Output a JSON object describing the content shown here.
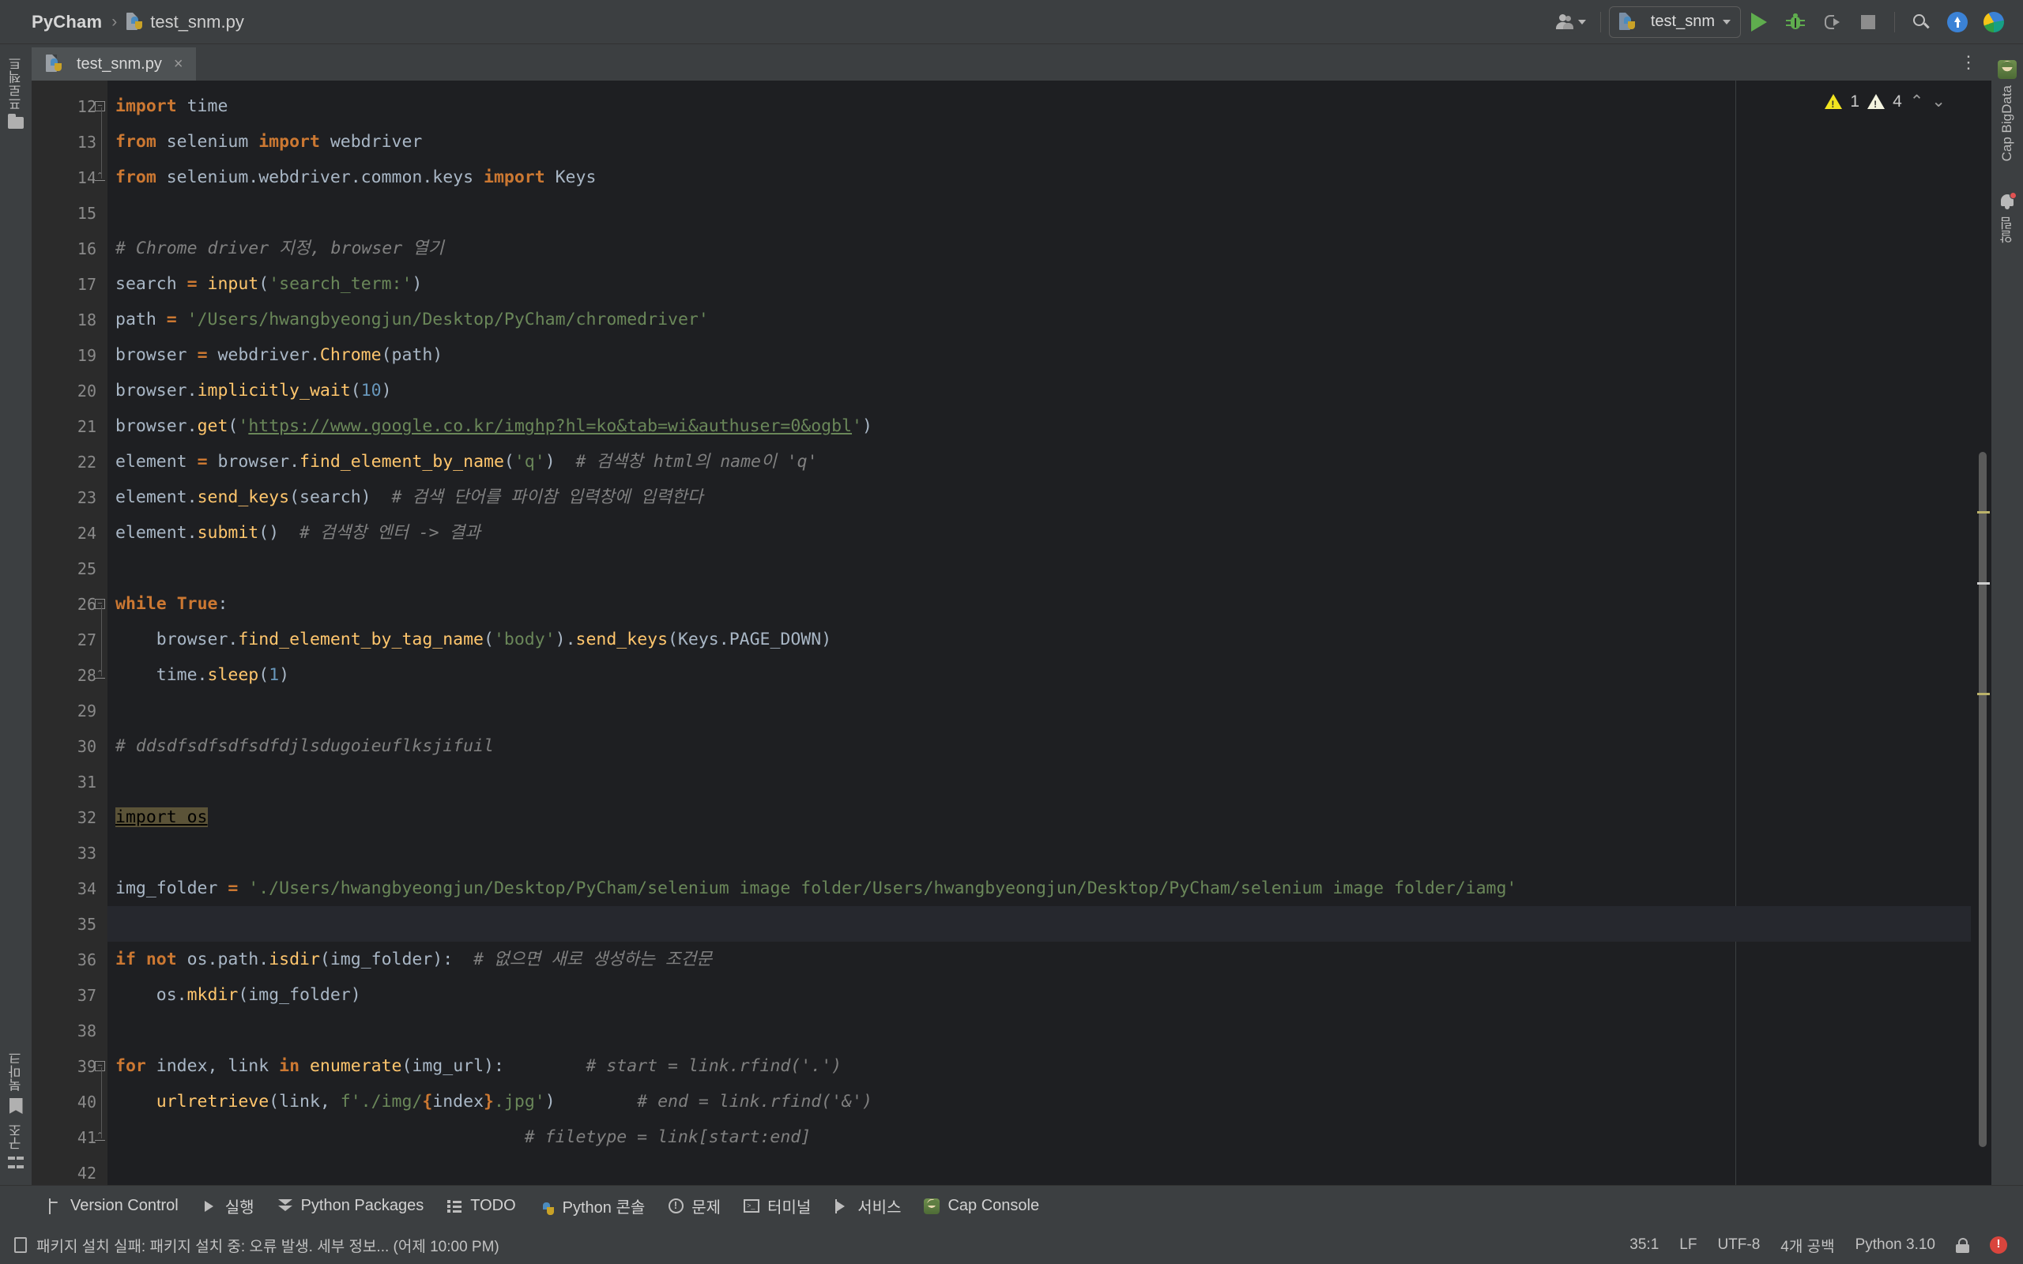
{
  "titlebar": {
    "project": "PyCham",
    "separator": "›",
    "file": "test_snm.py",
    "run_config": "test_snm",
    "icons": {
      "user": "user-accounts-icon",
      "run": "run-icon",
      "debug": "debug-icon",
      "coverage": "run-with-coverage-icon",
      "stop": "stop-icon",
      "search": "search-everywhere-icon",
      "update": "update-project-icon",
      "plugin": "code-with-me-icon"
    }
  },
  "left_rail": {
    "project": "프로젝트",
    "bookmarks": "북마크",
    "structure": "구조"
  },
  "right_rail": {
    "cap_bigdata": "Cap BigData",
    "notifications": "알림"
  },
  "tabs": [
    {
      "label": "test_snm.py",
      "close": "×",
      "active": true
    }
  ],
  "tab_overflow": "⋮",
  "inspections": {
    "warning_count": "1",
    "weak_warning_count": "4",
    "prev": "⌃",
    "next": "⌄"
  },
  "editor": {
    "first_line": 12,
    "current_line_index": 23,
    "lines": [
      {
        "n": 12,
        "fold": "minus",
        "tokens": [
          {
            "t": "import",
            "c": "k"
          },
          {
            "t": " time",
            "c": "id"
          }
        ]
      },
      {
        "n": 13,
        "tokens": [
          {
            "t": "from",
            "c": "k"
          },
          {
            "t": " selenium ",
            "c": "id"
          },
          {
            "t": "import",
            "c": "k"
          },
          {
            "t": " webdriver",
            "c": "id"
          }
        ]
      },
      {
        "n": 14,
        "fold": "end",
        "tokens": [
          {
            "t": "from",
            "c": "k"
          },
          {
            "t": " selenium.webdriver.common.keys ",
            "c": "id"
          },
          {
            "t": "import",
            "c": "k"
          },
          {
            "t": " Keys",
            "c": "id"
          }
        ]
      },
      {
        "n": 15,
        "tokens": []
      },
      {
        "n": 16,
        "tokens": [
          {
            "t": "# Chrome driver 지정, browser 열기",
            "c": "cm"
          }
        ]
      },
      {
        "n": 17,
        "tokens": [
          {
            "t": "search ",
            "c": "id"
          },
          {
            "t": "=",
            "c": "k"
          },
          {
            "t": " ",
            "c": "id"
          },
          {
            "t": "input",
            "c": "fn"
          },
          {
            "t": "(",
            "c": "pn"
          },
          {
            "t": "'search_term:'",
            "c": "s"
          },
          {
            "t": ")",
            "c": "pn"
          }
        ]
      },
      {
        "n": 18,
        "tokens": [
          {
            "t": "path ",
            "c": "id"
          },
          {
            "t": "=",
            "c": "k"
          },
          {
            "t": " ",
            "c": "id"
          },
          {
            "t": "'/Users/hwangbyeongjun/Desktop/PyCham/chromedriver'",
            "c": "s"
          }
        ]
      },
      {
        "n": 19,
        "tokens": [
          {
            "t": "browser ",
            "c": "id"
          },
          {
            "t": "=",
            "c": "k"
          },
          {
            "t": " webdriver.",
            "c": "id"
          },
          {
            "t": "Chrome",
            "c": "fn"
          },
          {
            "t": "(path)",
            "c": "pn"
          }
        ]
      },
      {
        "n": 20,
        "tokens": [
          {
            "t": "browser.",
            "c": "id"
          },
          {
            "t": "implicitly_wait",
            "c": "fn"
          },
          {
            "t": "(",
            "c": "pn"
          },
          {
            "t": "10",
            "c": "n"
          },
          {
            "t": ")",
            "c": "pn"
          }
        ]
      },
      {
        "n": 21,
        "tokens": [
          {
            "t": "browser.",
            "c": "id"
          },
          {
            "t": "get",
            "c": "fn"
          },
          {
            "t": "(",
            "c": "pn"
          },
          {
            "t": "'",
            "c": "s"
          },
          {
            "t": "https://www.google.co.kr/imghp?hl=ko&tab=wi&authuser=0&ogbl",
            "c": "url"
          },
          {
            "t": "'",
            "c": "s"
          },
          {
            "t": ")",
            "c": "pn"
          }
        ]
      },
      {
        "n": 22,
        "tokens": [
          {
            "t": "element ",
            "c": "id"
          },
          {
            "t": "=",
            "c": "k"
          },
          {
            "t": " browser.",
            "c": "id"
          },
          {
            "t": "find_element_by_name",
            "c": "fn"
          },
          {
            "t": "(",
            "c": "pn"
          },
          {
            "t": "'q'",
            "c": "s"
          },
          {
            "t": ")",
            "c": "pn"
          },
          {
            "t": "  # 검색창 html의 name이 'q'",
            "c": "cm"
          }
        ]
      },
      {
        "n": 23,
        "tokens": [
          {
            "t": "element.",
            "c": "id"
          },
          {
            "t": "send_keys",
            "c": "fn"
          },
          {
            "t": "(search)",
            "c": "pn"
          },
          {
            "t": "  # 검색 단어를 파이참 입력창에 입력한다",
            "c": "cm"
          }
        ]
      },
      {
        "n": 24,
        "tokens": [
          {
            "t": "element.",
            "c": "id"
          },
          {
            "t": "submit",
            "c": "fn"
          },
          {
            "t": "()",
            "c": "pn"
          },
          {
            "t": "  # 검색창 엔터 -> 결과",
            "c": "cm"
          }
        ]
      },
      {
        "n": 25,
        "tokens": []
      },
      {
        "n": 26,
        "fold": "minus",
        "tokens": [
          {
            "t": "while",
            "c": "k"
          },
          {
            "t": " ",
            "c": "id"
          },
          {
            "t": "True",
            "c": "k"
          },
          {
            "t": ":",
            "c": "pn"
          }
        ]
      },
      {
        "n": 27,
        "tokens": [
          {
            "t": "    browser.",
            "c": "id"
          },
          {
            "t": "find_element_by_tag_name",
            "c": "fn"
          },
          {
            "t": "(",
            "c": "pn"
          },
          {
            "t": "'body'",
            "c": "s"
          },
          {
            "t": ").",
            "c": "pn"
          },
          {
            "t": "send_keys",
            "c": "fn"
          },
          {
            "t": "(Keys.PAGE_DOWN)",
            "c": "pn"
          }
        ]
      },
      {
        "n": 28,
        "fold": "end",
        "tokens": [
          {
            "t": "    time.",
            "c": "id"
          },
          {
            "t": "sleep",
            "c": "fn"
          },
          {
            "t": "(",
            "c": "pn"
          },
          {
            "t": "1",
            "c": "n"
          },
          {
            "t": ")",
            "c": "pn"
          }
        ]
      },
      {
        "n": 29,
        "tokens": []
      },
      {
        "n": 30,
        "tokens": [
          {
            "t": "# ddsdfsdfsdfsdfdjlsdugoieuflksjifuil",
            "c": "cm"
          }
        ]
      },
      {
        "n": 31,
        "tokens": []
      },
      {
        "n": 32,
        "tokens": [
          {
            "t": "import os",
            "c": "hl u"
          }
        ]
      },
      {
        "n": 33,
        "tokens": []
      },
      {
        "n": 34,
        "tokens": [
          {
            "t": "img_folder ",
            "c": "id"
          },
          {
            "t": "=",
            "c": "k"
          },
          {
            "t": " ",
            "c": "id"
          },
          {
            "t": "'./Users/hwangbyeongjun/Desktop/PyCham/selenium image folder/Users/hwangbyeongjun/Desktop/PyCham/selenium image folder/iamg'",
            "c": "s u"
          }
        ]
      },
      {
        "n": 35,
        "tokens": [],
        "current": true
      },
      {
        "n": 36,
        "tokens": [
          {
            "t": "if",
            "c": "k"
          },
          {
            "t": " ",
            "c": "id"
          },
          {
            "t": "not",
            "c": "k"
          },
          {
            "t": " os.path.",
            "c": "id"
          },
          {
            "t": "isdir",
            "c": "fn"
          },
          {
            "t": "(img_folder):",
            "c": "pn"
          },
          {
            "t": "  # 없으면 새로 생성하는 조건문",
            "c": "cm"
          }
        ]
      },
      {
        "n": 37,
        "tokens": [
          {
            "t": "    os.",
            "c": "id"
          },
          {
            "t": "mkdir",
            "c": "fn"
          },
          {
            "t": "(img_folder)",
            "c": "pn"
          }
        ]
      },
      {
        "n": 38,
        "tokens": []
      },
      {
        "n": 39,
        "fold": "minus",
        "tokens": [
          {
            "t": "for",
            "c": "k"
          },
          {
            "t": " index, link ",
            "c": "id"
          },
          {
            "t": "in",
            "c": "k"
          },
          {
            "t": " ",
            "c": "id"
          },
          {
            "t": "enumerate",
            "c": "fn"
          },
          {
            "t": "(img_url):",
            "c": "pn"
          },
          {
            "t": "        # start = link.rfind('.')",
            "c": "cm"
          }
        ]
      },
      {
        "n": 40,
        "tokens": [
          {
            "t": "    ",
            "c": "id"
          },
          {
            "t": "urlretrieve",
            "c": "fn"
          },
          {
            "t": "(link, ",
            "c": "pn"
          },
          {
            "t": "f'./img/",
            "c": "s"
          },
          {
            "t": "{",
            "c": "k"
          },
          {
            "t": "index",
            "c": "id"
          },
          {
            "t": "}",
            "c": "k"
          },
          {
            "t": ".jpg'",
            "c": "s"
          },
          {
            "t": ")",
            "c": "pn"
          },
          {
            "t": "        # end = link.rfind('&')",
            "c": "cm"
          }
        ]
      },
      {
        "n": 41,
        "fold": "end",
        "tokens": [
          {
            "t": "                                        # filetype = link[start:end]",
            "c": "cm"
          }
        ]
      },
      {
        "n": 42,
        "tokens": []
      }
    ]
  },
  "bottom_tools": [
    {
      "label": "Version Control",
      "icon": "version-control-icon"
    },
    {
      "label": "실행",
      "icon": "run-icon"
    },
    {
      "label": "Python Packages",
      "icon": "python-packages-icon"
    },
    {
      "label": "TODO",
      "icon": "todo-icon"
    },
    {
      "label": "Python 콘솔",
      "icon": "python-console-icon"
    },
    {
      "label": "문제",
      "icon": "problems-icon"
    },
    {
      "label": "터미널",
      "icon": "terminal-icon"
    },
    {
      "label": "서비스",
      "icon": "services-icon"
    },
    {
      "label": "Cap Console",
      "icon": "cap-console-icon"
    }
  ],
  "statusbar": {
    "message": "패키지 설치 실패: 패키지 설치 중: 오류 발생. 세부 정보... (어제 10:00 PM)",
    "caret": "35:1",
    "line_sep": "LF",
    "encoding": "UTF-8",
    "indent": "4개 공백",
    "interpreter": "Python 3.10",
    "lock_icon": "lock-icon",
    "error_icon": "error-badge-icon"
  },
  "colors": {
    "accent": "#4a88c7",
    "keyword": "#cc7832",
    "string": "#6a8759",
    "function": "#ffc66d",
    "number": "#6897bb",
    "comment": "#808080",
    "editor_bg": "#1e1f22",
    "chrome_bg": "#3c3f41",
    "error": "#d9453d"
  }
}
